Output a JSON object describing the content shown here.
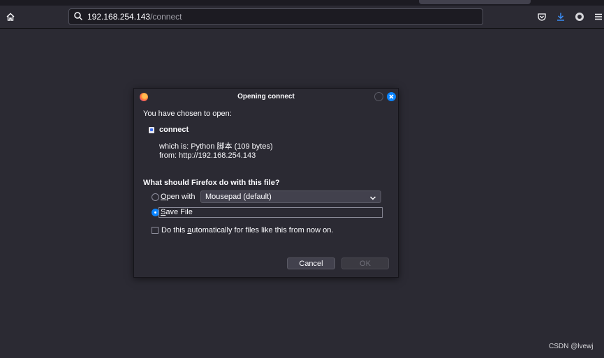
{
  "browser": {
    "url_host": "192.168.254.143",
    "url_path": "/connect",
    "toolbar_icons": [
      "home-icon",
      "search-icon",
      "pocket-icon",
      "download-icon",
      "extension-icon",
      "menu-icon"
    ]
  },
  "dialog": {
    "title": "Opening connect",
    "intro": "You have chosen to open:",
    "file_name": "connect",
    "which_is": "which is:  Python 脚本 (109 bytes)",
    "from": "from:  http://192.168.254.143",
    "question": "What should Firefox do with this file?",
    "open_with_label_u": "O",
    "open_with_label_rest": "pen with",
    "open_with_selected": "Mousepad (default)",
    "open_with_checked": false,
    "save_file_label_u": "S",
    "save_file_label_rest": "ave File",
    "save_file_checked": true,
    "auto_pre": "Do this ",
    "auto_u": "a",
    "auto_post": "utomatically for files like this from now on.",
    "auto_checked": false,
    "cancel_label": "Cancel",
    "ok_label": "OK"
  },
  "colors": {
    "accent": "#0a84ff",
    "background": "#2b2a33"
  },
  "watermark": "CSDN @lvewj"
}
